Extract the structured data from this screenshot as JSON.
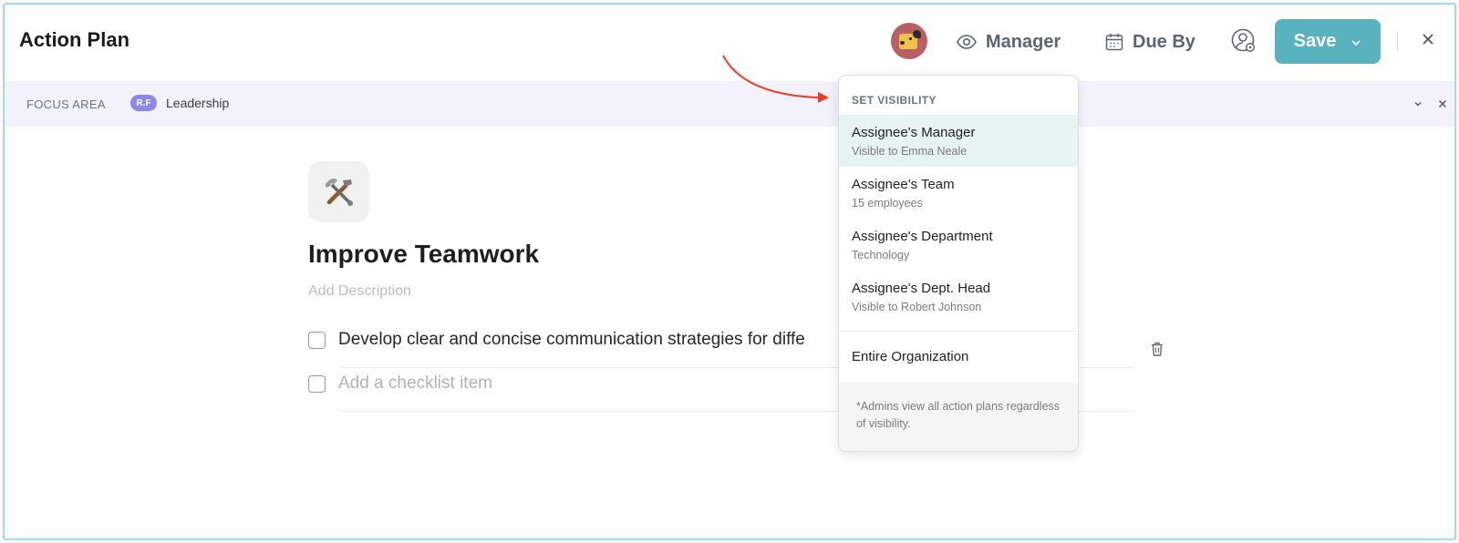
{
  "header": {
    "title": "Action Plan",
    "visibility_label": "Manager",
    "due_label": "Due By",
    "save_label": "Save"
  },
  "focus_area": {
    "label": "FOCUS AREA",
    "badge": "R.F",
    "name": "Leadership"
  },
  "plan": {
    "emoji": "🛠️",
    "title": "Improve Teamwork",
    "description_placeholder": "Add Description",
    "checklist": [
      {
        "text": "Develop clear and concise communication strategies for diffe"
      }
    ],
    "checklist_placeholder": "Add a checklist item"
  },
  "visibility_menu": {
    "header": "SET VISIBILITY",
    "options": [
      {
        "title": "Assignee's Manager",
        "subtitle": "Visible to Emma Neale",
        "selected": true
      },
      {
        "title": "Assignee's Team",
        "subtitle": "15 employees",
        "selected": false
      },
      {
        "title": "Assignee's Department",
        "subtitle": "Technology",
        "selected": false
      },
      {
        "title": "Assignee's Dept. Head",
        "subtitle": "Visible to Robert Johnson",
        "selected": false
      }
    ],
    "organization_option": "Entire Organization",
    "footnote": "*Admins view all action plans regardless of visibility."
  },
  "colors": {
    "accent": "#58b3bf",
    "selected_bg": "#e6f3f3",
    "focus_bar_bg": "#f3f1fb",
    "badge": "#8c87e8",
    "annotation_arrow": "#e8402a"
  },
  "icons": [
    "eye-icon",
    "calendar-icon",
    "user-settings-icon",
    "chevron-down-icon",
    "close-icon",
    "trash-icon"
  ]
}
